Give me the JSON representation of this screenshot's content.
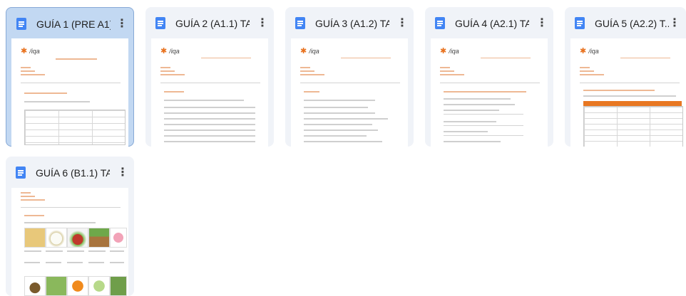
{
  "cards": [
    {
      "title": "GUÍA 1 (PRE A1) ...",
      "brand": "/iqa",
      "menu_icon": "more-vert-icon"
    },
    {
      "title": "GUÍA 2 (A1.1) TA...",
      "brand": "/iqa",
      "menu_icon": "more-vert-icon"
    },
    {
      "title": "GUÍA 3 (A1.2) TA...",
      "brand": "/iqa",
      "menu_icon": "more-vert-icon"
    },
    {
      "title": "GUÍA 4 (A2.1) TA...",
      "brand": "/iqa",
      "menu_icon": "more-vert-icon"
    },
    {
      "title": "GUÍA 5 (A2.2) T...",
      "brand": "/iqa",
      "menu_icon": "more-vert-icon"
    },
    {
      "title": "GUÍA 6 (B1.1) TA...",
      "brand": "",
      "menu_icon": "more-vert-icon"
    }
  ],
  "selected_card_index": 0,
  "colors": {
    "selected_bg": "#c2d8f2",
    "card_bg": "#f0f3f8",
    "doc_icon": "#4285f4",
    "accent_orange": "#e87722"
  }
}
